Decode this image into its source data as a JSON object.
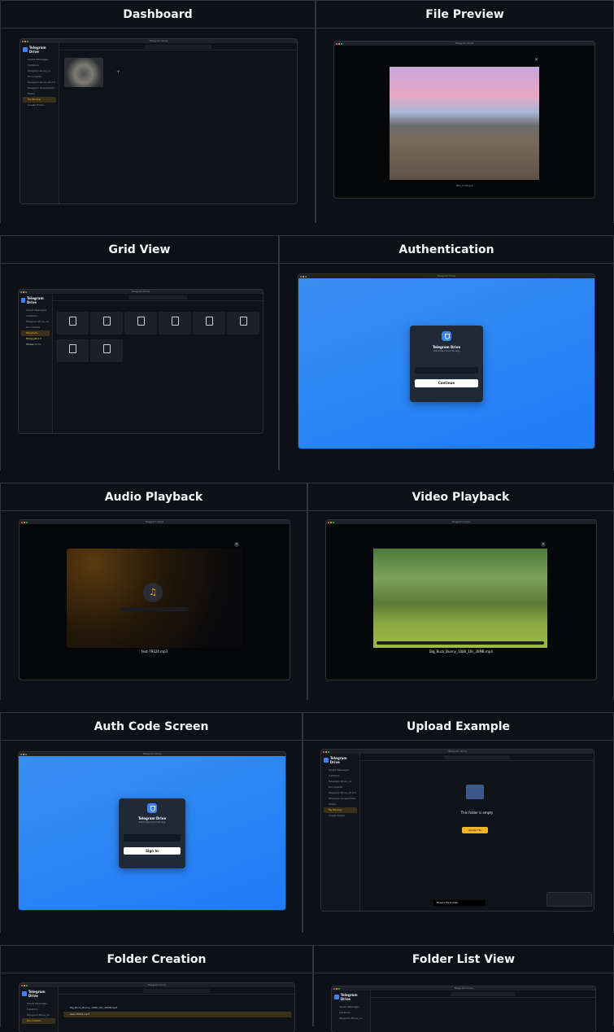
{
  "sections": {
    "dashboard": "Dashboard",
    "file_preview": "File Preview",
    "grid_view": "Grid View",
    "authentication": "Authentication",
    "audio_playback": "Audio Playback",
    "video_playback": "Video Playback",
    "auth_code_screen": "Auth Code Screen",
    "upload_example": "Upload Example",
    "folder_creation": "Folder Creation",
    "folder_list_view": "Folder List View"
  },
  "app": {
    "window_title": "Telegram Drive",
    "name": "Telegram Drive",
    "subtitle": "Self-Hosted Cloud Storage",
    "continue": "Continue",
    "sign_in": "Sign In",
    "upload_file": "Upload File",
    "empty_title": "This folder is empty",
    "toast": "Moved 1 file to trash"
  },
  "sidebar_items": [
    "Saved Messages",
    "Installers",
    "Telegram-Drive_v1",
    "Documents",
    "Telegram-Drive_v0.4.0",
    "Telegram Screenshots",
    "Media",
    "My Backup",
    "Create Folder"
  ],
  "files": {
    "preview": "IMG_9798.jpg",
    "audio": "test-79324.mp3",
    "video": "Big_Buck_Bunny_1080_10s_30MB.mp4"
  },
  "colors": {
    "accent": "#3b82f6",
    "active": "#f0b429",
    "bg": "#0d1117"
  }
}
